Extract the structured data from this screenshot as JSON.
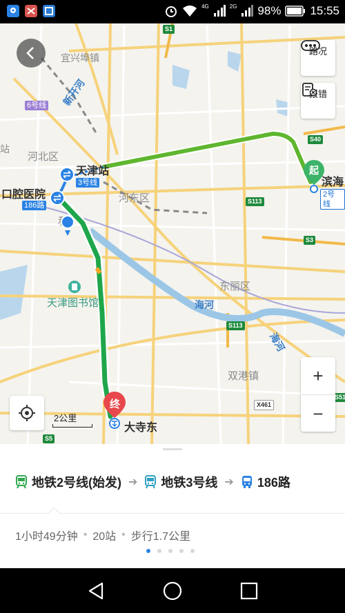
{
  "status_bar": {
    "time": "15:55",
    "battery": "98%",
    "net_4g": "4G",
    "net_2g": "2G"
  },
  "map": {
    "places": {
      "yixing": "宜兴埠镇",
      "hebei": "河北区",
      "hedong": "河东区",
      "dongli": "东丽区",
      "shuanggang": "双港镇",
      "library": "天津图书馆",
      "zhan_partial": "站",
      "he_partial": "和"
    },
    "rivers": {
      "xinkai": "新开河",
      "haihe1": "海河",
      "haihe2": "海河"
    },
    "stations": {
      "tianjin": "天津站",
      "kouqiang": "口腔医院",
      "binhai": "滨海",
      "dasidong": "大寺东"
    },
    "line_badges": {
      "line6": "6号线",
      "line3": "3号线",
      "bus186": "186路",
      "line2": "2号线"
    },
    "road_badges": {
      "s1": "S1",
      "s40": "S40",
      "s113a": "S113",
      "s3": "S3",
      "s113b": "S113",
      "x461": "X461",
      "s5": "S5",
      "s51": "S51"
    },
    "markers": {
      "start": "起",
      "end": "终"
    },
    "buttons": {
      "traffic": "路况",
      "report": "报错"
    },
    "zoom_in": "+",
    "zoom_out": "−",
    "scale": "2公里"
  },
  "route": {
    "segments": [
      {
        "icon": "subway-icon",
        "label": "地铁2号线(始发)",
        "color": "#2fa84f"
      },
      {
        "icon": "subway-icon",
        "label": "地铁3号线",
        "color": "#2fa0c4"
      },
      {
        "icon": "bus-icon",
        "label": "186路",
        "color": "#2a82e4"
      }
    ],
    "duration": "1小时49分钟",
    "stops": "20站",
    "walk": "步行1.7公里",
    "page_count": 5,
    "active_page": 1
  }
}
